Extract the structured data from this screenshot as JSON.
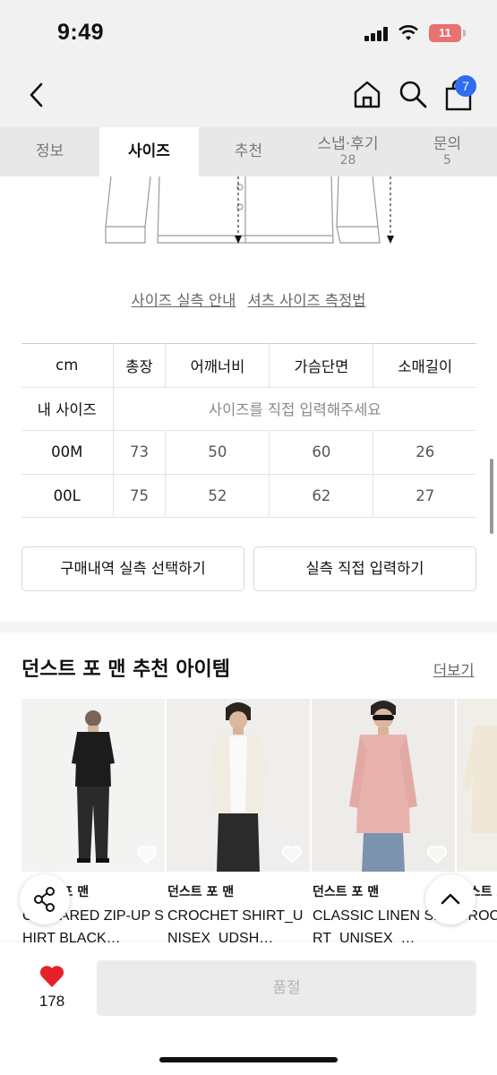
{
  "status_bar": {
    "time": "9:49",
    "battery": "11"
  },
  "nav": {
    "cart_count": "7"
  },
  "tabs": [
    {
      "label": "정보",
      "count": ""
    },
    {
      "label": "사이즈",
      "count": ""
    },
    {
      "label": "추천",
      "count": ""
    },
    {
      "label": "스냅·후기",
      "count": "28"
    },
    {
      "label": "문의",
      "count": "5"
    }
  ],
  "active_tab": "사이즈",
  "guides": {
    "size_guide": "사이즈 실측 안내",
    "shirt_measure": "셔츠 사이즈 측정법"
  },
  "size_table": {
    "unit": "cm",
    "columns": [
      "총장",
      "어깨너비",
      "가슴단면",
      "소매길이"
    ],
    "my_size_label": "내 사이즈",
    "my_size_hint": "사이즈를 직접 입력해주세요",
    "rows": [
      {
        "size": "00M",
        "values": [
          "73",
          "50",
          "60",
          "26"
        ]
      },
      {
        "size": "00L",
        "values": [
          "75",
          "52",
          "62",
          "27"
        ]
      }
    ]
  },
  "buttons": {
    "purchase_history": "구매내역 실측 선택하기",
    "direct_input": "실측 직접 입력하기"
  },
  "recommended": {
    "title": "던스트 포 맨 추천 아이템",
    "more": "더보기",
    "products": [
      {
        "brand": "던스트 포 맨",
        "name": "COLLARED ZIP-UP SHIRT BLACK…"
      },
      {
        "brand": "던스트 포 맨",
        "name": "CROCHET SHIRT_UNISEX_UDSH…"
      },
      {
        "brand": "던스트 포 맨",
        "name": "CLASSIC LINEN SHIRT_UNISEX_…"
      },
      {
        "brand": "던스트 포 맨",
        "name": "CROCHET COL…"
      }
    ]
  },
  "bottom": {
    "likes": "178",
    "cta": "품절"
  },
  "colors": {
    "accent": "#2e6cf0",
    "like": "#e8202a",
    "battery": "#e87171"
  }
}
